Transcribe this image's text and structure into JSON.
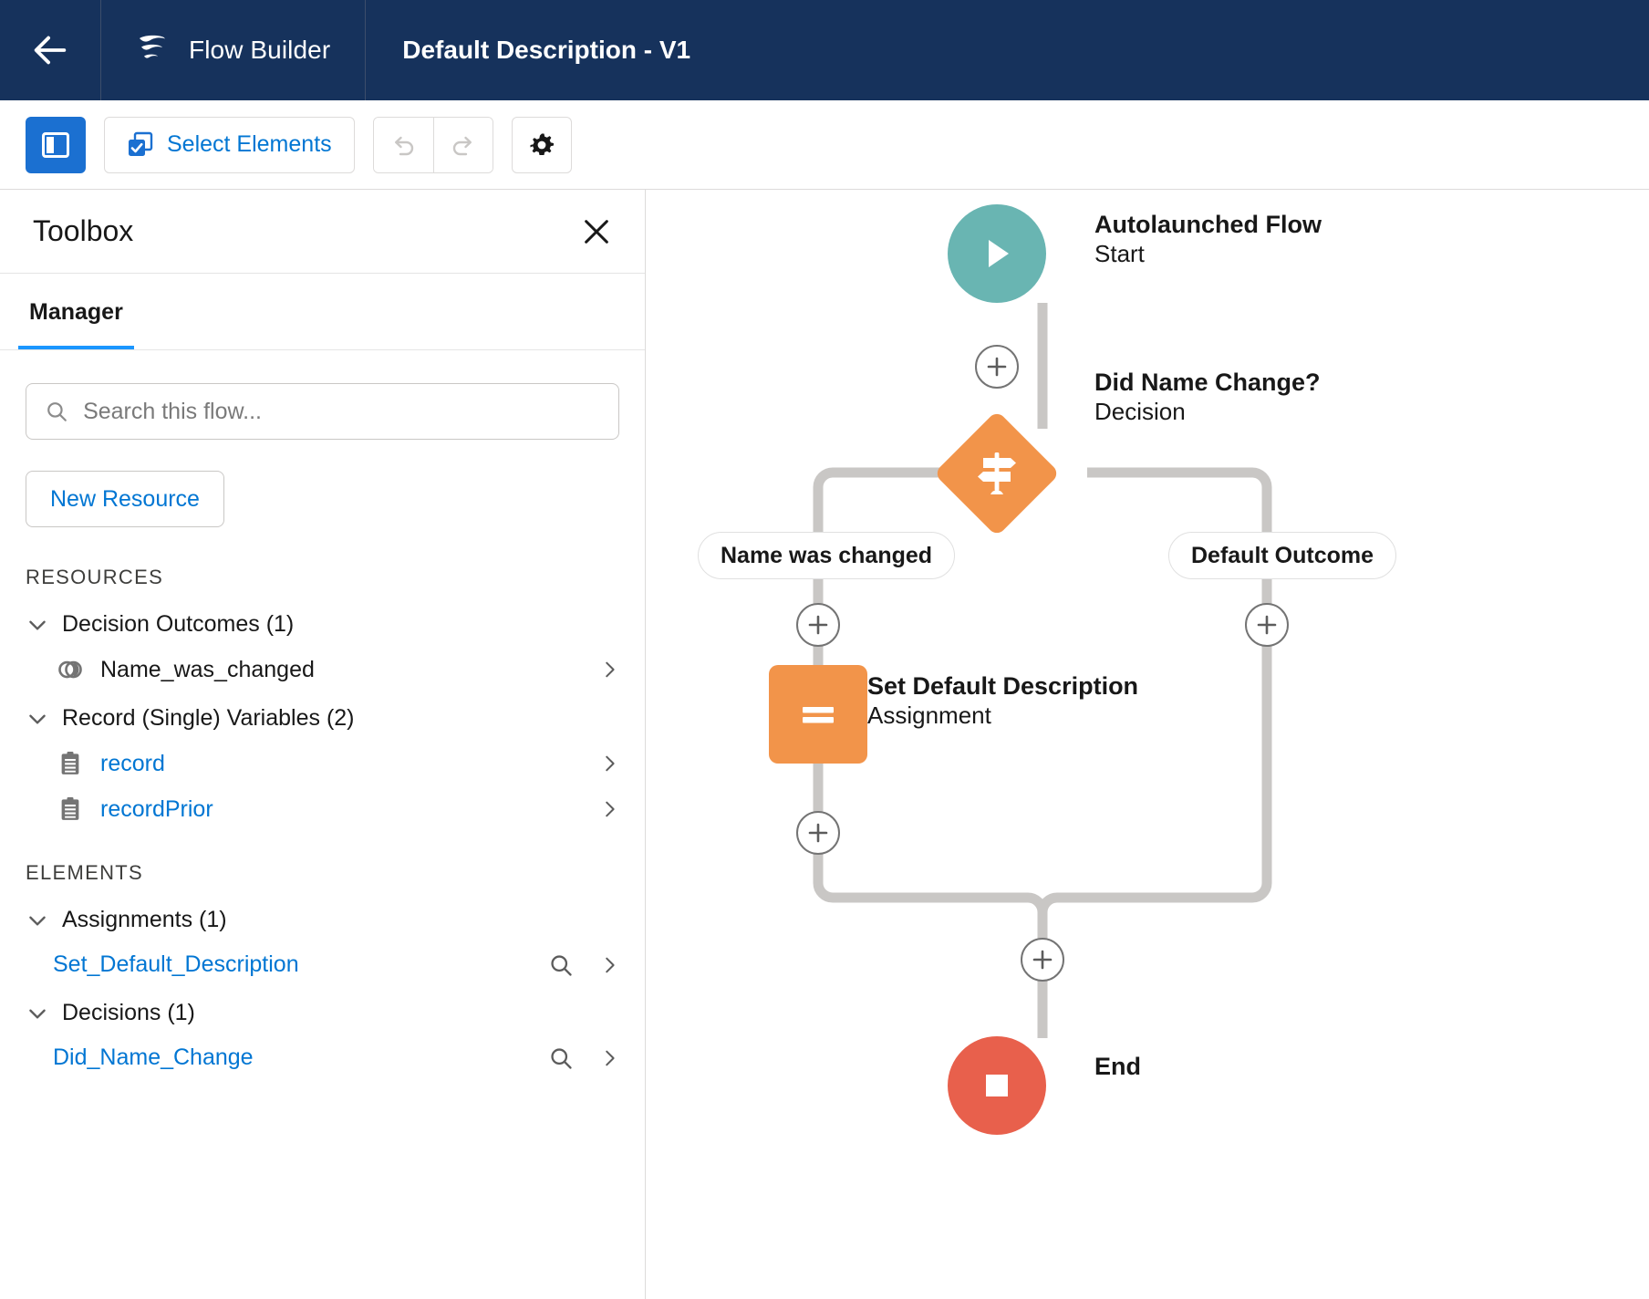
{
  "header": {
    "back_icon": "arrow-left-icon",
    "logo_icon": "salesforce-flow-logo",
    "app_name": "Flow Builder",
    "flow_title": "Default Description - V1"
  },
  "toolbar": {
    "toggle_panel_icon": "panel-toggle-icon",
    "select_elements_icon": "select-elements-icon",
    "select_elements_label": "Select Elements",
    "undo_icon": "undo-icon",
    "redo_icon": "redo-icon",
    "settings_icon": "gear-icon"
  },
  "toolbox": {
    "title": "Toolbox",
    "close_icon": "close-icon",
    "tabs": [
      {
        "label": "Manager",
        "active": true
      }
    ],
    "search": {
      "icon": "search-icon",
      "placeholder": "Search this flow...",
      "value": ""
    },
    "new_resource_label": "New Resource",
    "resources_header": "RESOURCES",
    "elements_header": "ELEMENTS",
    "resource_groups": [
      {
        "label": "Decision Outcomes (1)",
        "expanded": true,
        "items": [
          {
            "label": "Name_was_changed",
            "icon": "outcome-icon",
            "link": false,
            "has_search": false
          }
        ]
      },
      {
        "label": "Record (Single) Variables (2)",
        "expanded": true,
        "items": [
          {
            "label": "record",
            "icon": "record-variable-icon",
            "link": true,
            "has_search": false
          },
          {
            "label": "recordPrior",
            "icon": "record-variable-icon",
            "link": true,
            "has_search": false
          }
        ]
      }
    ],
    "element_groups": [
      {
        "label": "Assignments (1)",
        "expanded": true,
        "items": [
          {
            "label": "Set_Default_Description",
            "icon": "",
            "link": true,
            "has_search": true
          }
        ]
      },
      {
        "label": "Decisions (1)",
        "expanded": true,
        "items": [
          {
            "label": "Did_Name_Change",
            "icon": "",
            "link": true,
            "has_search": true
          }
        ]
      }
    ]
  },
  "canvas": {
    "nodes": [
      {
        "id": "start",
        "title": "Autolaunched Flow",
        "subtitle": "Start",
        "icon": "play-icon",
        "color": "#69b5b2",
        "shape": "circle"
      },
      {
        "id": "decision",
        "title": "Did Name Change?",
        "subtitle": "Decision",
        "icon": "signpost-icon",
        "color": "#f2944a",
        "shape": "diamond"
      },
      {
        "id": "assignment",
        "title": "Set Default Description",
        "subtitle": "Assignment",
        "icon": "equals-icon",
        "color": "#f2944a",
        "shape": "square"
      },
      {
        "id": "end",
        "title": "End",
        "subtitle": "",
        "icon": "stop-icon",
        "color": "#e8604c",
        "shape": "circle"
      }
    ],
    "branches": [
      {
        "id": "left",
        "label": "Name was changed"
      },
      {
        "id": "right",
        "label": "Default Outcome"
      }
    ],
    "add_buttons": [
      {
        "id": "add-after-start"
      },
      {
        "id": "add-left-branch"
      },
      {
        "id": "add-right-branch"
      },
      {
        "id": "add-after-assignment"
      },
      {
        "id": "add-before-end"
      }
    ],
    "connector_color": "#c9c7c5"
  }
}
